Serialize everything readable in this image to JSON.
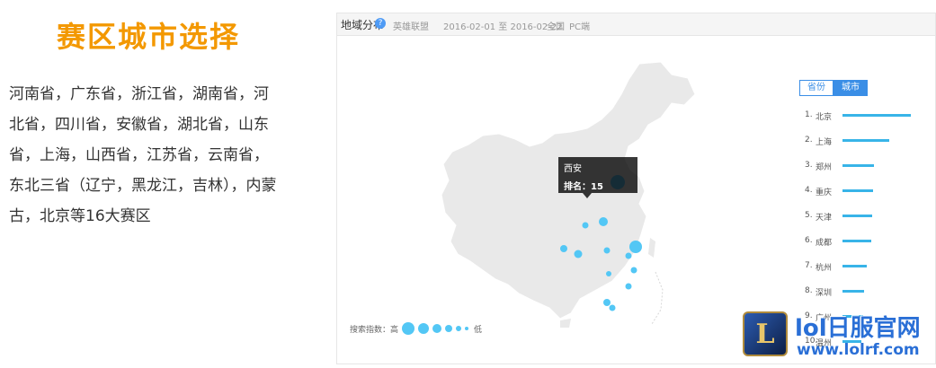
{
  "left": {
    "title": "赛区城市选择",
    "description": "河南省，广东省，浙江省，湖南省，河北省，四川省，安徽省，湖北省，山东省，上海，山西省，江苏省，云南省，东北三省（辽宁，黑龙江，吉林），内蒙古，北京等16大赛区"
  },
  "panel": {
    "title": "地域分布",
    "help_icon": "help-icon",
    "game": "英雄联盟",
    "date_range": "2016-02-01 至 2016-02-22",
    "scope": "全国",
    "platform": "PC端",
    "toggle": {
      "province": "省份",
      "city": "城市",
      "active": "city"
    },
    "tooltip": {
      "city": "西安",
      "rank_label": "排名：15"
    },
    "ranking": [
      {
        "no": "1.",
        "name": "北京",
        "value": 100
      },
      {
        "no": "2.",
        "name": "上海",
        "value": 68
      },
      {
        "no": "3.",
        "name": "郑州",
        "value": 46
      },
      {
        "no": "4.",
        "name": "重庆",
        "value": 45
      },
      {
        "no": "5.",
        "name": "天津",
        "value": 43
      },
      {
        "no": "6.",
        "name": "成都",
        "value": 42
      },
      {
        "no": "7.",
        "name": "杭州",
        "value": 36
      },
      {
        "no": "8.",
        "name": "深圳",
        "value": 32
      },
      {
        "no": "9.",
        "name": "广州",
        "value": 30
      },
      {
        "no": "10.",
        "name": "温州",
        "value": 28
      }
    ],
    "legend": {
      "prefix": "搜索指数：高",
      "suffix": "低"
    },
    "map_color": "#e9e9e9",
    "dot_color": "#53c7f5"
  },
  "watermark": {
    "logo_letter": "L",
    "line1": "lol日服官网",
    "line2": "www.lolrf.com"
  }
}
